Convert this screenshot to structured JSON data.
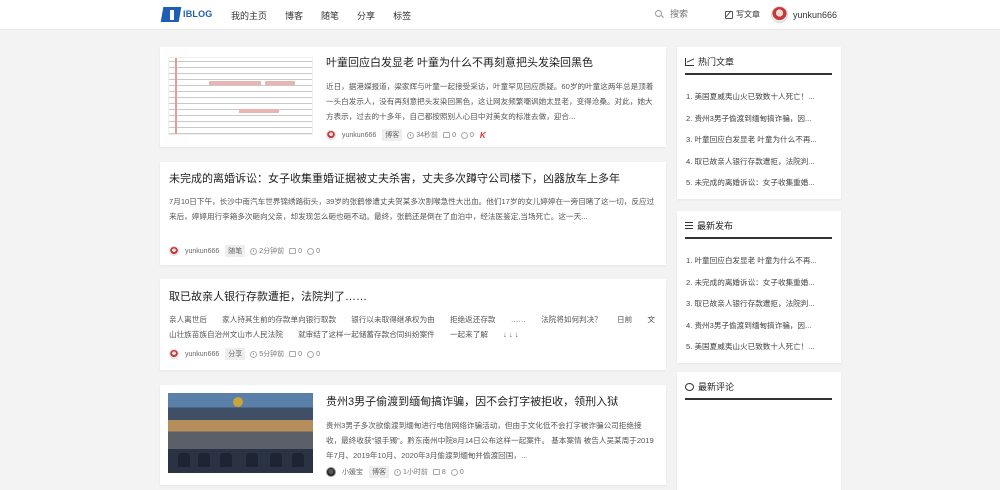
{
  "header": {
    "logo_text": "IBLOG",
    "nav": [
      "我的主页",
      "博客",
      "随笔",
      "分享",
      "标签"
    ],
    "search_placeholder": "搜索",
    "write_label": "写文章",
    "username": "yunkun666"
  },
  "posts": [
    {
      "title": "叶童回应白发显老 叶童为什么不再刻意把头发染回黑色",
      "excerpt": "近日，据港媒报道，梁家辉与叶童一起接受采访，叶童罕见回应质疑。60岁的叶童这两年总是顶着一头白发示人，没有再刻意把头发染回黑色，这让网友频繁嘲讽她太显老，变得沧桑。对此，她大方表示，过去的十多年，自己都按照别人心目中对美女的标准去做，迎合...",
      "author": "yunkun666",
      "tag": "博客",
      "time": "34秒前",
      "comments": "0",
      "likes": "0",
      "thumb": "document-scan"
    },
    {
      "title": "未完成的离婚诉讼：女子收集重婚证据被丈夫杀害，丈夫多次蹲守公司楼下，凶器放车上多年",
      "excerpt": "7月10日下午，长沙中南汽车世界锦绣路街头，39岁的张鹤惨遭丈夫贺某多次割喉急性大出血。他们17岁的女儿婷婷在一旁目睹了这一切，反应过来后，婷婷用行李箱多次砸向父亲，却发现怎么砸也砸不动。最终，张鹤还是倒在了血泊中，经法医鉴定,当场死亡。这一天...",
      "author": "yunkun666",
      "tag": "随笔",
      "time": "2分钟前",
      "comments": "0",
      "likes": "0"
    },
    {
      "title": "取已故亲人银行存款遭拒，法院判了……",
      "excerpt": "亲人离世后　　家人持其生前的存款单向银行取款　　银行以未取得继承权为由　　拒绝返还存款　　……　　法院将如何判决？　　日前　　文山壮族苗族自治州文山市人民法院　　就审结了这样一起储蓄存款合同纠纷案件　　一起来了解　　↓ ↓ ↓",
      "author": "yunkun666",
      "tag": "分享",
      "time": "5分钟前",
      "comments": "0",
      "likes": "0"
    },
    {
      "title": "贵州3男子偷渡到缅甸搞诈骗，因不会打字被拒收，领刑入狱",
      "excerpt": "贵州3男子多次欲偷渡到缅甸进行电信网络诈骗活动，但由于文化低不会打字被诈骗公司拒绝接收，最终收获\"银手镯\"。黔东南州中院8月14日公布这样一起案件。 基本案情 被告人吴某周于2019年7月、2019年10月、2020年3月偷渡到缅甸并偷渡回国，...",
      "author": "小媛宝",
      "tag": "博客",
      "time": "1小时前",
      "comments": "8",
      "likes": "0",
      "thumb": "courtroom-photo"
    }
  ],
  "sidebar": {
    "hot": {
      "title": "热门文章",
      "items": [
        "1. 美国夏威夷山火已致数十人死亡！...",
        "2. 贵州3男子偷渡到缅甸搞诈骗，因...",
        "3. 叶童回应白发显老 叶童为什么不再...",
        "4. 取已故亲人银行存款遭拒，法院判...",
        "5. 未完成的离婚诉讼：女子收集重婚..."
      ]
    },
    "latest": {
      "title": "最新发布",
      "items": [
        "1. 叶童回应白发显老 叶童为什么不再...",
        "2. 未完成的离婚诉讼：女子收集重婚...",
        "3. 取已故亲人银行存款遭拒，法院判...",
        "4. 贵州3男子偷渡到缅甸搞诈骗，因...",
        "5. 美国夏威夷山火已致数十人死亡！..."
      ]
    },
    "comments": {
      "title": "最新评论"
    }
  },
  "colors": {
    "brand": "#1d5fb8",
    "background": "#f3f3f3",
    "accent_red": "#d6312d"
  }
}
